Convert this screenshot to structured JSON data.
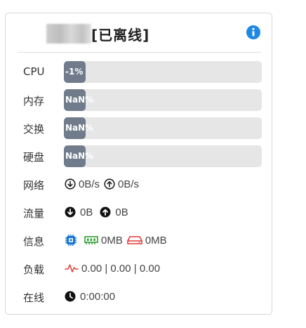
{
  "header": {
    "title": "[已离线]",
    "info_icon": "info-icon"
  },
  "metrics": [
    {
      "label": "CPU",
      "value_text": "-1%",
      "fill_fraction": 0.11
    },
    {
      "label": "内存",
      "value_text": "NaN%",
      "fill_fraction": 0.11
    },
    {
      "label": "交换",
      "value_text": "NaN%",
      "fill_fraction": 0.11
    },
    {
      "label": "硬盘",
      "value_text": "NaN%",
      "fill_fraction": 0.11
    }
  ],
  "network": {
    "label": "网络",
    "down": "0B/s",
    "up": "0B/s"
  },
  "traffic": {
    "label": "流量",
    "down": "0B",
    "up": "0B"
  },
  "info": {
    "label": "信息",
    "ram": "0MB",
    "disk": "0MB"
  },
  "load": {
    "label": "负载",
    "value": "0.00 | 0.00 | 0.00"
  },
  "uptime": {
    "label": "在线",
    "value": "0:00:00"
  },
  "colors": {
    "bar_fill": "#707c8c",
    "bar_track": "#e6e6e6",
    "info_blue": "#1e88e5",
    "cpu_blue": "#1976d2",
    "ram_green": "#2e9d2e",
    "disk_red": "#e53935",
    "load_red": "#e53935"
  }
}
